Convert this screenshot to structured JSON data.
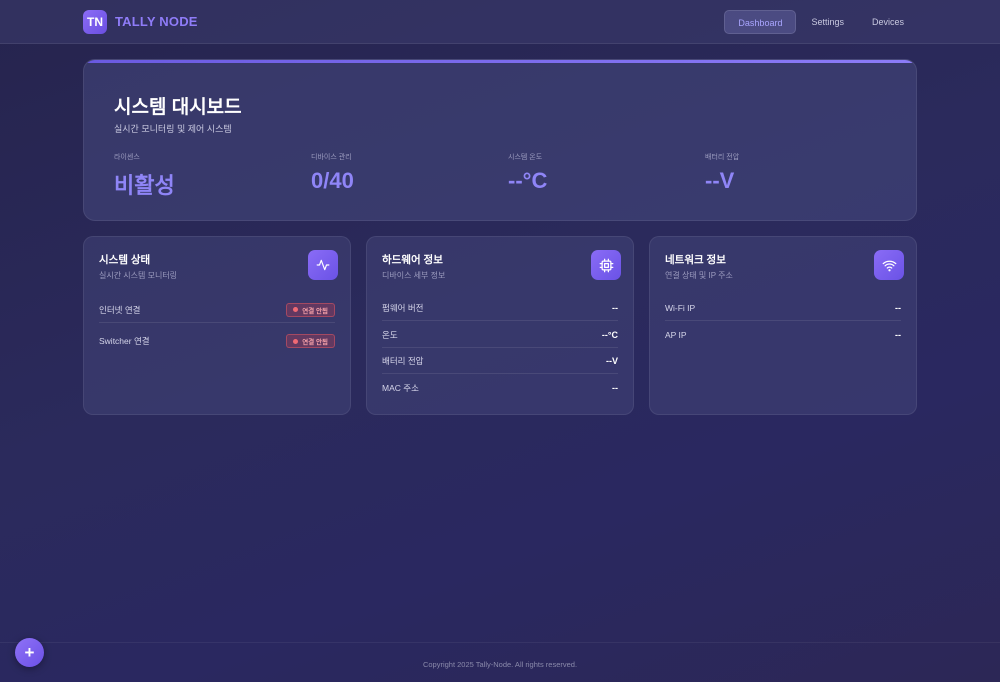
{
  "header": {
    "logo_text": "TN",
    "brand": "TALLY NODE",
    "nav": [
      "Dashboard",
      "Settings",
      "Devices"
    ],
    "active_nav": "Dashboard"
  },
  "hero": {
    "title": "시스템 대시보드",
    "subtitle": "실시간 모니터링 및 제어 시스템",
    "stats": [
      {
        "label": "라이센스",
        "value": "비활성"
      },
      {
        "label": "디바이스 관리",
        "value": "0/40"
      },
      {
        "label": "시스템 온도",
        "value": "--°C"
      },
      {
        "label": "배터리 전압",
        "value": "--V"
      }
    ]
  },
  "cards": {
    "system_status": {
      "title": "시스템 상태",
      "subtitle": "실시간 시스템 모니터링",
      "icon": "activity-icon",
      "rows": [
        {
          "label": "인터넷 연결",
          "badge": "연결 안됨"
        },
        {
          "label": "Switcher 연결",
          "badge": "연결 안됨"
        }
      ]
    },
    "hardware": {
      "title": "하드웨어 정보",
      "subtitle": "디바이스 세부 정보",
      "icon": "cpu-icon",
      "rows": [
        {
          "label": "펌웨어 버전",
          "value": "--"
        },
        {
          "label": "온도",
          "value": "--°C"
        },
        {
          "label": "배터리 전압",
          "value": "--V"
        },
        {
          "label": "MAC 주소",
          "value": "--"
        }
      ]
    },
    "network": {
      "title": "네트워크 정보",
      "subtitle": "연결 상태 및 IP 주소",
      "icon": "wifi-icon",
      "rows": [
        {
          "label": "Wi-Fi IP",
          "value": "--"
        },
        {
          "label": "AP IP",
          "value": "--"
        }
      ]
    }
  },
  "footer": {
    "copyright": "Copyright 2025 Tally-Node. All rights reserved."
  },
  "fab": {
    "label": "+"
  },
  "colors": {
    "accent": "#8f85f7",
    "brand": "#8f7cf8",
    "error": "#f06a74"
  }
}
